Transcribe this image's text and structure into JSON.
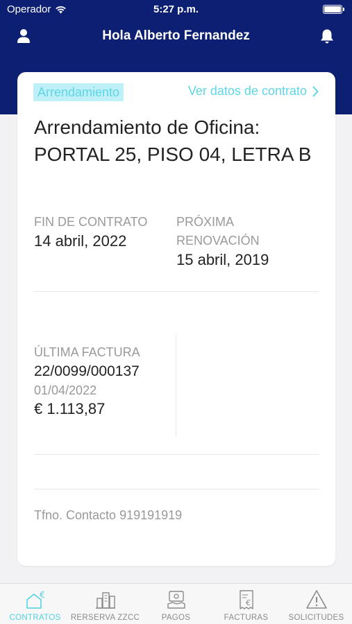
{
  "status_bar": {
    "carrier": "Operador",
    "time": "5:27 p.m."
  },
  "topbar": {
    "greeting": "Hola Alberto Fernandez",
    "left_icon": "user-icon",
    "right_icon": "bell-icon"
  },
  "contract": {
    "tag": "Arrendamiento",
    "link": "Ver datos de contrato",
    "title": "Arrendamiento de Oficina: PORTAL 25, PISO 04, LETRA B",
    "fin_label": "FIN DE CONTRATO",
    "fin_value": "14 abril, 2022",
    "renovacion_label": "PRÓXIMA RENOVACIÓN",
    "renovacion_value": "15 abril, 2019",
    "ultima_factura_label": "ÚLTIMA FACTURA",
    "ultima_factura_number": "22/0099/000137",
    "ultima_factura_date": "01/04/2022",
    "ultima_factura_amount": "€ 1.113,87",
    "contact": "Tfno. Contacto 919191919"
  },
  "tabs": [
    {
      "label": "CONTRATOS",
      "icon": "house-euro-icon",
      "active": true
    },
    {
      "label": "RERSERVA ZZCC",
      "icon": "city-icon",
      "active": false
    },
    {
      "label": "PAGOS",
      "icon": "payment-icon",
      "active": false
    },
    {
      "label": "FACTURAS",
      "icon": "invoice-icon",
      "active": false
    },
    {
      "label": "SOLICITUDES",
      "icon": "warning-icon",
      "active": false
    }
  ],
  "colors": {
    "header": "#0d1f72",
    "accent": "#5cd6e6",
    "tag_bg": "#bff0f7"
  }
}
